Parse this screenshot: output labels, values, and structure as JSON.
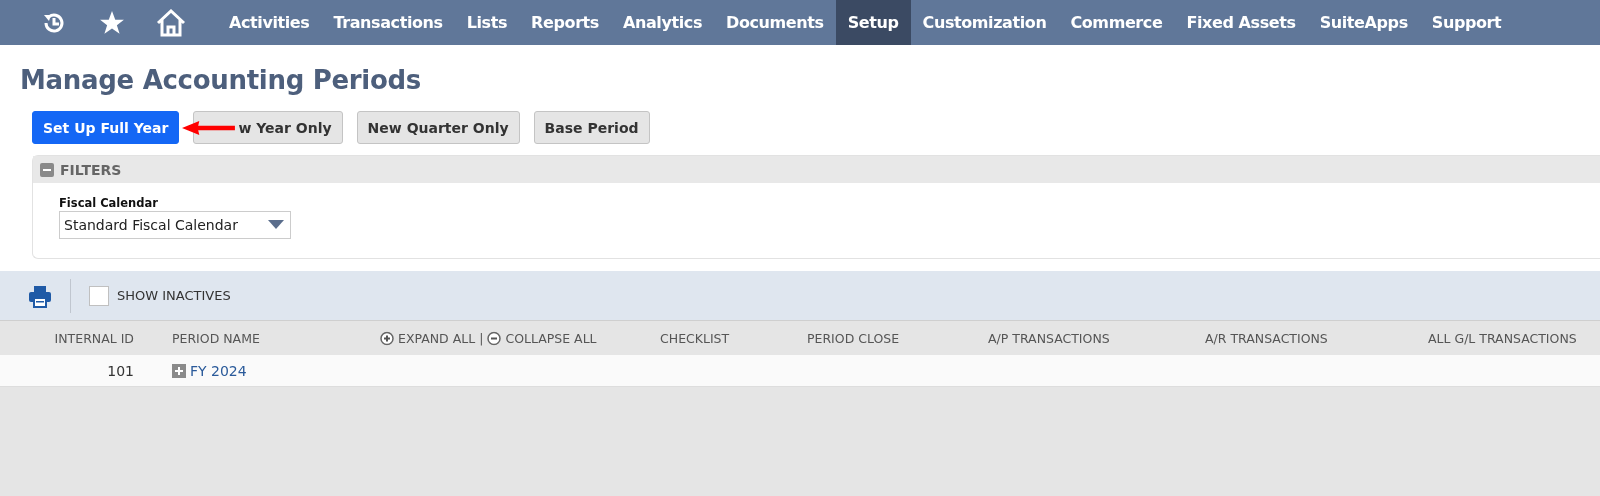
{
  "nav": {
    "tabs": [
      {
        "label": "Activities",
        "selected": false
      },
      {
        "label": "Transactions",
        "selected": false
      },
      {
        "label": "Lists",
        "selected": false
      },
      {
        "label": "Reports",
        "selected": false
      },
      {
        "label": "Analytics",
        "selected": false
      },
      {
        "label": "Documents",
        "selected": false
      },
      {
        "label": "Setup",
        "selected": true
      },
      {
        "label": "Customization",
        "selected": false
      },
      {
        "label": "Commerce",
        "selected": false
      },
      {
        "label": "Fixed Assets",
        "selected": false
      },
      {
        "label": "SuiteApps",
        "selected": false
      },
      {
        "label": "Support",
        "selected": false
      }
    ]
  },
  "page_title": "Manage Accounting Periods",
  "buttons": [
    {
      "label": "Set Up Full Year",
      "kind": "primary"
    },
    {
      "label": "w Year Only",
      "kind": "secondary"
    },
    {
      "label": "New Quarter Only",
      "kind": "secondary"
    },
    {
      "label": "Base Period",
      "kind": "secondary"
    }
  ],
  "filters": {
    "title": "FILTERS",
    "expanded": true,
    "field_label": "Fiscal Calendar",
    "field_value": "Standard Fiscal Calendar"
  },
  "toolbar": {
    "show_inactives": {
      "label": "SHOW INACTIVES",
      "checked": false
    }
  },
  "table": {
    "columns": [
      "INTERNAL ID",
      "PERIOD NAME",
      "CHECKLIST",
      "PERIOD CLOSE",
      "A/P TRANSACTIONS",
      "A/R TRANSACTIONS",
      "ALL G/L TRANSACTIONS"
    ],
    "expand_all": "EXPAND ALL",
    "separator": "|",
    "collapse_all": "COLLAPSE ALL",
    "rows": [
      {
        "internal_id": "101",
        "period_name": "FY 2024",
        "expanded": false
      }
    ]
  }
}
